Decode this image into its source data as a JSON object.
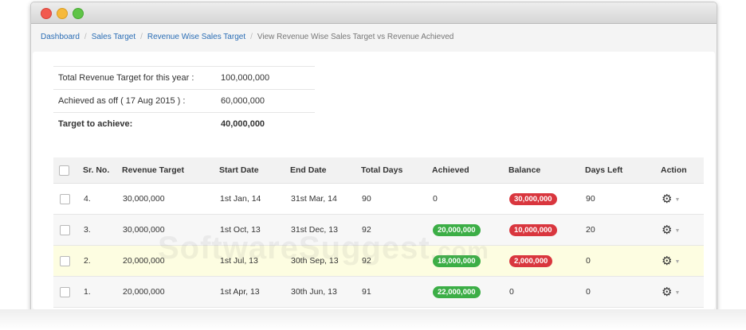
{
  "breadcrumb": {
    "items": [
      "Dashboard",
      "Sales Target",
      "Revenue Wise Sales Target"
    ],
    "current": "View Revenue Wise Sales Target vs Revenue Achieved"
  },
  "summary": [
    {
      "label": "Total Revenue Target for this year :",
      "value": "100,000,000"
    },
    {
      "label": "Achieved as off ( 17 Aug 2015 ) :",
      "value": "60,000,000"
    },
    {
      "label": "Target to achieve:",
      "value": "40,000,000"
    }
  ],
  "table": {
    "headers": [
      "Sr. No.",
      "Revenue Target",
      "Start Date",
      "End Date",
      "Total Days",
      "Achieved",
      "Balance",
      "Days Left",
      "Action"
    ],
    "rows": [
      {
        "sr": "4.",
        "target": "30,000,000",
        "start": "1st Jan, 14",
        "end": "31st Mar, 14",
        "days": "90",
        "achieved": "0",
        "balance": "30,000,000",
        "days_left": "90"
      },
      {
        "sr": "3.",
        "target": "30,000,000",
        "start": "1st Oct, 13",
        "end": "31st Dec, 13",
        "days": "92",
        "achieved": "20,000,000",
        "balance": "10,000,000",
        "days_left": "20"
      },
      {
        "sr": "2.",
        "target": "20,000,000",
        "start": "1st Jul, 13",
        "end": "30th Sep, 13",
        "days": "92",
        "achieved": "18,000,000",
        "balance": "2,000,000",
        "days_left": "0"
      },
      {
        "sr": "1.",
        "target": "20,000,000",
        "start": "1st Apr, 13",
        "end": "30th Jun, 13",
        "days": "91",
        "achieved": "22,000,000",
        "balance": "0",
        "days_left": "0"
      }
    ]
  },
  "icons": {
    "action": "gear-icon",
    "dropdown": "caret-down-icon"
  },
  "colors": {
    "link": "#2a6db5",
    "badge_green": "#3cae46",
    "badge_red": "#d9363e",
    "highlight_row": "#fdfde1"
  },
  "watermark": {
    "text": "SoftwareSuggest",
    "suffix": ".com"
  }
}
